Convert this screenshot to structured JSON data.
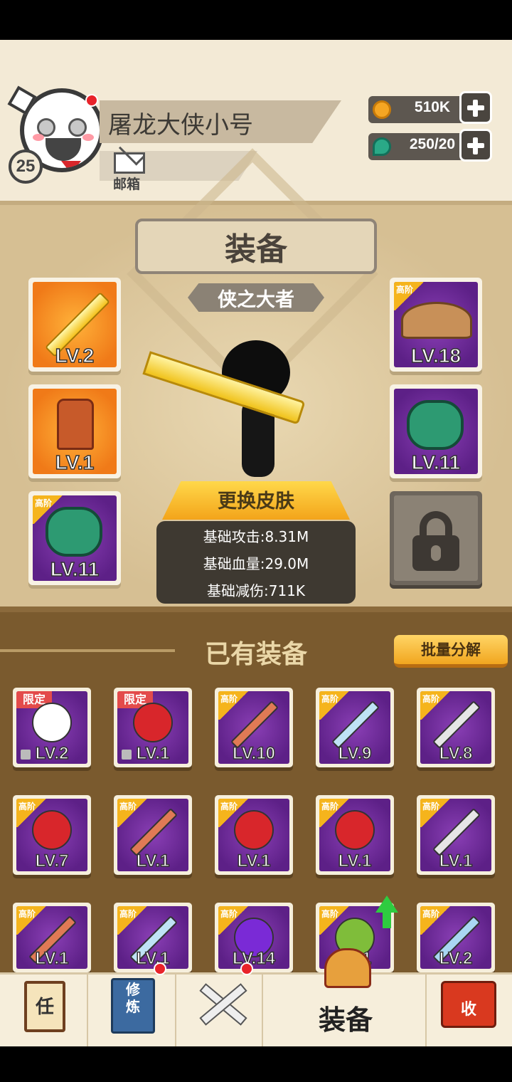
{
  "player": {
    "name": "屠龙大侠小号",
    "level": "25",
    "mail_label": "邮箱"
  },
  "resources": [
    {
      "name": "coins",
      "value": "510K",
      "icon": "coin-icon",
      "color": "#f5a623"
    },
    {
      "name": "gems",
      "value": "250/20",
      "icon": "jade-icon",
      "color": "#2aa987"
    }
  ],
  "equipment": {
    "title": "装备",
    "subtitle": "侠之大者",
    "skin_button": "更换皮肤",
    "stats": [
      {
        "label": "基础攻击:8.31M"
      },
      {
        "label": "基础血量:29.0M"
      },
      {
        "label": "基础减伤:711K"
      }
    ],
    "slots_left": [
      {
        "item": "golden-sword",
        "level": "LV.2",
        "tier": ""
      },
      {
        "item": "armor",
        "level": "LV.1",
        "tier": ""
      },
      {
        "item": "green-gauntlet",
        "level": "LV.11",
        "tier": "高阶"
      }
    ],
    "slots_right": [
      {
        "item": "straw-hat",
        "level": "LV.18",
        "tier": "高阶"
      },
      {
        "item": "green-gauntlet",
        "level": "LV.11",
        "tier": ""
      },
      {
        "item": "locked",
        "level": "",
        "tier": ""
      }
    ]
  },
  "inventory": {
    "title": "已有装备",
    "batch_button": "批量分解",
    "items": [
      {
        "item": "scroll",
        "level": "LV.2",
        "tag": "限定",
        "locked": true
      },
      {
        "item": "red-knot",
        "level": "LV.1",
        "tag": "限定",
        "locked": true
      },
      {
        "item": "wooden-sword",
        "level": "LV.10",
        "tag": "高阶",
        "locked": false
      },
      {
        "item": "blue-saber",
        "level": "LV.9",
        "tag": "高阶",
        "locked": false
      },
      {
        "item": "gray-saber",
        "level": "LV.8",
        "tag": "高阶",
        "locked": false
      },
      {
        "item": "red-gauntlet",
        "level": "LV.7",
        "tag": "高阶",
        "locked": false
      },
      {
        "item": "wooden-sword",
        "level": "LV.1",
        "tag": "高阶",
        "locked": false
      },
      {
        "item": "red-gauntlet",
        "level": "LV.1",
        "tag": "高阶",
        "locked": false
      },
      {
        "item": "red-gauntlet",
        "level": "LV.1",
        "tag": "高阶",
        "locked": false
      },
      {
        "item": "gray-saber",
        "level": "LV.1",
        "tag": "高阶",
        "locked": false
      },
      {
        "item": "wooden-sword",
        "level": "LV.1",
        "tag": "高阶",
        "locked": false
      },
      {
        "item": "blue-saber",
        "level": "LV.1",
        "tag": "高阶",
        "locked": false
      },
      {
        "item": "purple-orb",
        "level": "LV.14",
        "tag": "高阶",
        "locked": false
      },
      {
        "item": "jade-ring",
        "level": "LV.1",
        "tag": "高阶",
        "locked": false
      },
      {
        "item": "blue-sword",
        "level": "LV.2",
        "tag": "高阶",
        "locked": false
      }
    ]
  },
  "nav": [
    {
      "name": "tasks",
      "label": "任",
      "icon": "scroll-icon"
    },
    {
      "name": "cultivation",
      "label": "修炼",
      "icon": "book-icon"
    },
    {
      "name": "battle",
      "label": "",
      "icon": "crossed-swords-icon"
    },
    {
      "name": "equipment",
      "label": "装备",
      "icon": "helmet-icon",
      "active": true
    },
    {
      "name": "collect",
      "label": "收",
      "icon": "pavilion-icon"
    }
  ]
}
